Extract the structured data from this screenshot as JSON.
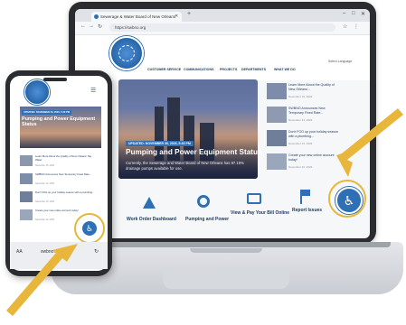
{
  "browser": {
    "tab_title": "Sewerage & Water Board of New Orleans",
    "url": "https://swbno.org"
  },
  "site": {
    "nav": [
      "CUSTOMER SERVICE",
      "COMMUNICATIONS",
      "PROJECTS",
      "DEPARTMENTS",
      "WHAT WE DO"
    ],
    "language_label": "Select Language",
    "hero": {
      "badge": "UPDATED: NOVEMBER 30, 2023, 5:30 PM",
      "title": "Pumping and Power Equipment Status",
      "subtitle": "Currently, the Sewerage and Water Board of New Orleans has 97.19% drainage pumps available for use."
    },
    "news": [
      {
        "title": "Learn More About the Quality of New Orleans'...",
        "date": "November 15, 2023"
      },
      {
        "title": "SWBNO Announces New Temporary Fixed Rate...",
        "date": "November 13, 2023"
      },
      {
        "title": "Don't FOG up your holiday season with a plumbing...",
        "date": "November 13, 2023"
      },
      {
        "title": "Create your new online account today!",
        "date": "November 10, 2023"
      }
    ],
    "quick_links": [
      "Work Order Dashboard",
      "Pumping and Power",
      "View & Pay Your Bill Online",
      "Report Issues"
    ],
    "accessibility_glyph": "♿"
  },
  "phone": {
    "badge": "UPDATED: NOVEMBER 30, 2023, 5:30 PM",
    "hero_title": "Pumping and Power Equipment Status",
    "news": [
      {
        "title": "Learn More About the Quality of New Orleans' Tap Water",
        "date": "November 15, 2023"
      },
      {
        "title": "SWBNO Announces New Temporary Fixed Rate...",
        "date": "November 13, 2023"
      },
      {
        "title": "Don't FOG up your holiday season with a plumbing...",
        "date": "November 13, 2023"
      },
      {
        "title": "Create your new online account today!",
        "date": "November 10, 2023"
      }
    ],
    "url": "swbno.org",
    "aa": "AA"
  },
  "colors": {
    "brand": "#2e6fb5",
    "highlight": "#e8b63a"
  }
}
